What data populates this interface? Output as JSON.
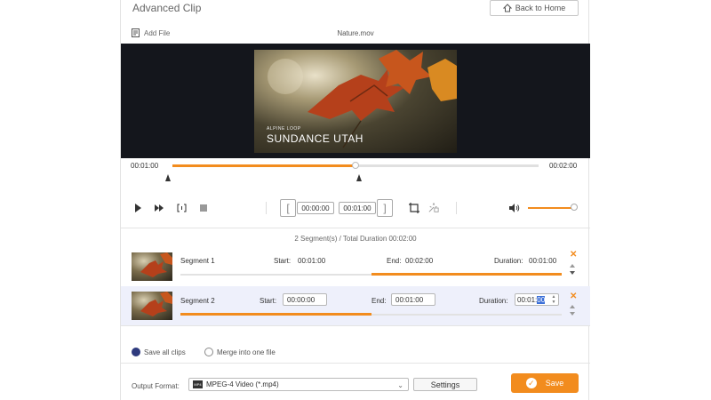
{
  "window": {
    "title": "Advanced Clip",
    "back_home_label": "Back to Home",
    "add_file_label": "Add File",
    "file_name": "Nature.mov"
  },
  "preview": {
    "caption_small": "ALPINE LOOP",
    "caption_big": "SUNDANCE UTAH"
  },
  "timeline": {
    "current_time": "00:01:00",
    "total_time": "00:02:00",
    "progress": 0.5
  },
  "controls": {
    "play": "play-icon",
    "fast_forward": "fast-forward-icon",
    "split": "split-icon",
    "stop": "stop-icon",
    "start_field": "00:00:00",
    "end_field": "00:01:00",
    "volume_level": 0.9
  },
  "summary": "2 Segment(s) / Total Duration 00:02:00",
  "segments": [
    {
      "label": "Segment 1",
      "start_label": "Start:",
      "start": "00:01:00",
      "end_label": "End:",
      "end": "00:02:00",
      "duration_label": "Duration:",
      "duration": "00:01:00",
      "range_start": 0.5,
      "range_end": 1.0
    },
    {
      "label": "Segment 2",
      "start_label": "Start:",
      "start": "00:00:00",
      "end_label": "End:",
      "end": "00:01:00",
      "duration_label": "Duration:",
      "duration_prefix": "00:01:",
      "duration_selected": "00",
      "range_start": 0.0,
      "range_end": 0.5
    }
  ],
  "options": {
    "save_all_label": "Save all clips",
    "merge_label": "Merge into one file",
    "selected": "save_all"
  },
  "output": {
    "label": "Output Format:",
    "format": "MPEG-4 Video (*.mp4)",
    "settings_label": "Settings",
    "save_label": "Save"
  },
  "colors": {
    "accent": "#f28c1e",
    "selected_row": "#eef0fb",
    "radio_on": "#2f3b7e"
  }
}
